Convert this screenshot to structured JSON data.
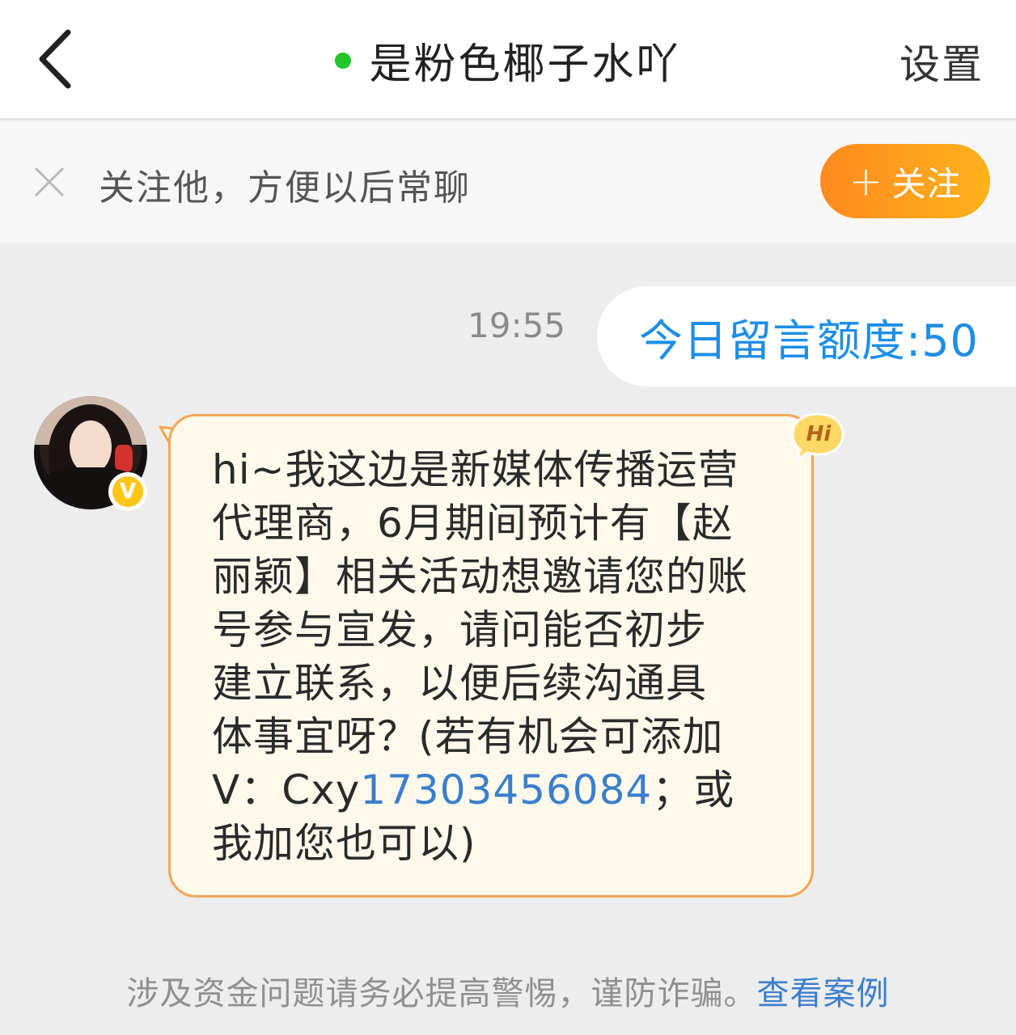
{
  "header": {
    "back_icon": "chevron-left-icon",
    "title": "是粉色椰子水吖",
    "online_status_color": "#22c52a",
    "settings_label": "设置"
  },
  "follow_banner": {
    "close_icon": "close-icon",
    "text": "关注他，方便以后常聊",
    "follow_button_plus": "+",
    "follow_button_label": "关注",
    "button_color": "#ff9a1f"
  },
  "chat": {
    "timestamp": "19:55",
    "quota_message": "今日留言额度:50",
    "incoming_message": {
      "avatar": "avatar-image",
      "verified_badge": "V",
      "hi_badge": "Hi",
      "lines": [
        "hi~我这边是新媒体传播运营",
        "代理商，6月期间预计有【赵",
        "丽颖】相关活动想邀请您的账",
        "号参与宣发，请问能否初步",
        "建立联系，以便后续沟通具",
        "体事宜呀？(若有机会可添加"
      ],
      "line7_prefix": "V：Cxy",
      "phone_number": "17303456084",
      "line7_suffix": "；或",
      "line8": "我加您也可以)"
    }
  },
  "footer": {
    "warning_text": "涉及资金问题请务必提高警惕，谨防诈骗。",
    "warning_link": "查看案例"
  },
  "colors": {
    "accent_blue": "#1e8ee6",
    "link_blue": "#3a7fcb",
    "bubble_fill": "#fff9ec",
    "bubble_border": "#f2a653"
  }
}
